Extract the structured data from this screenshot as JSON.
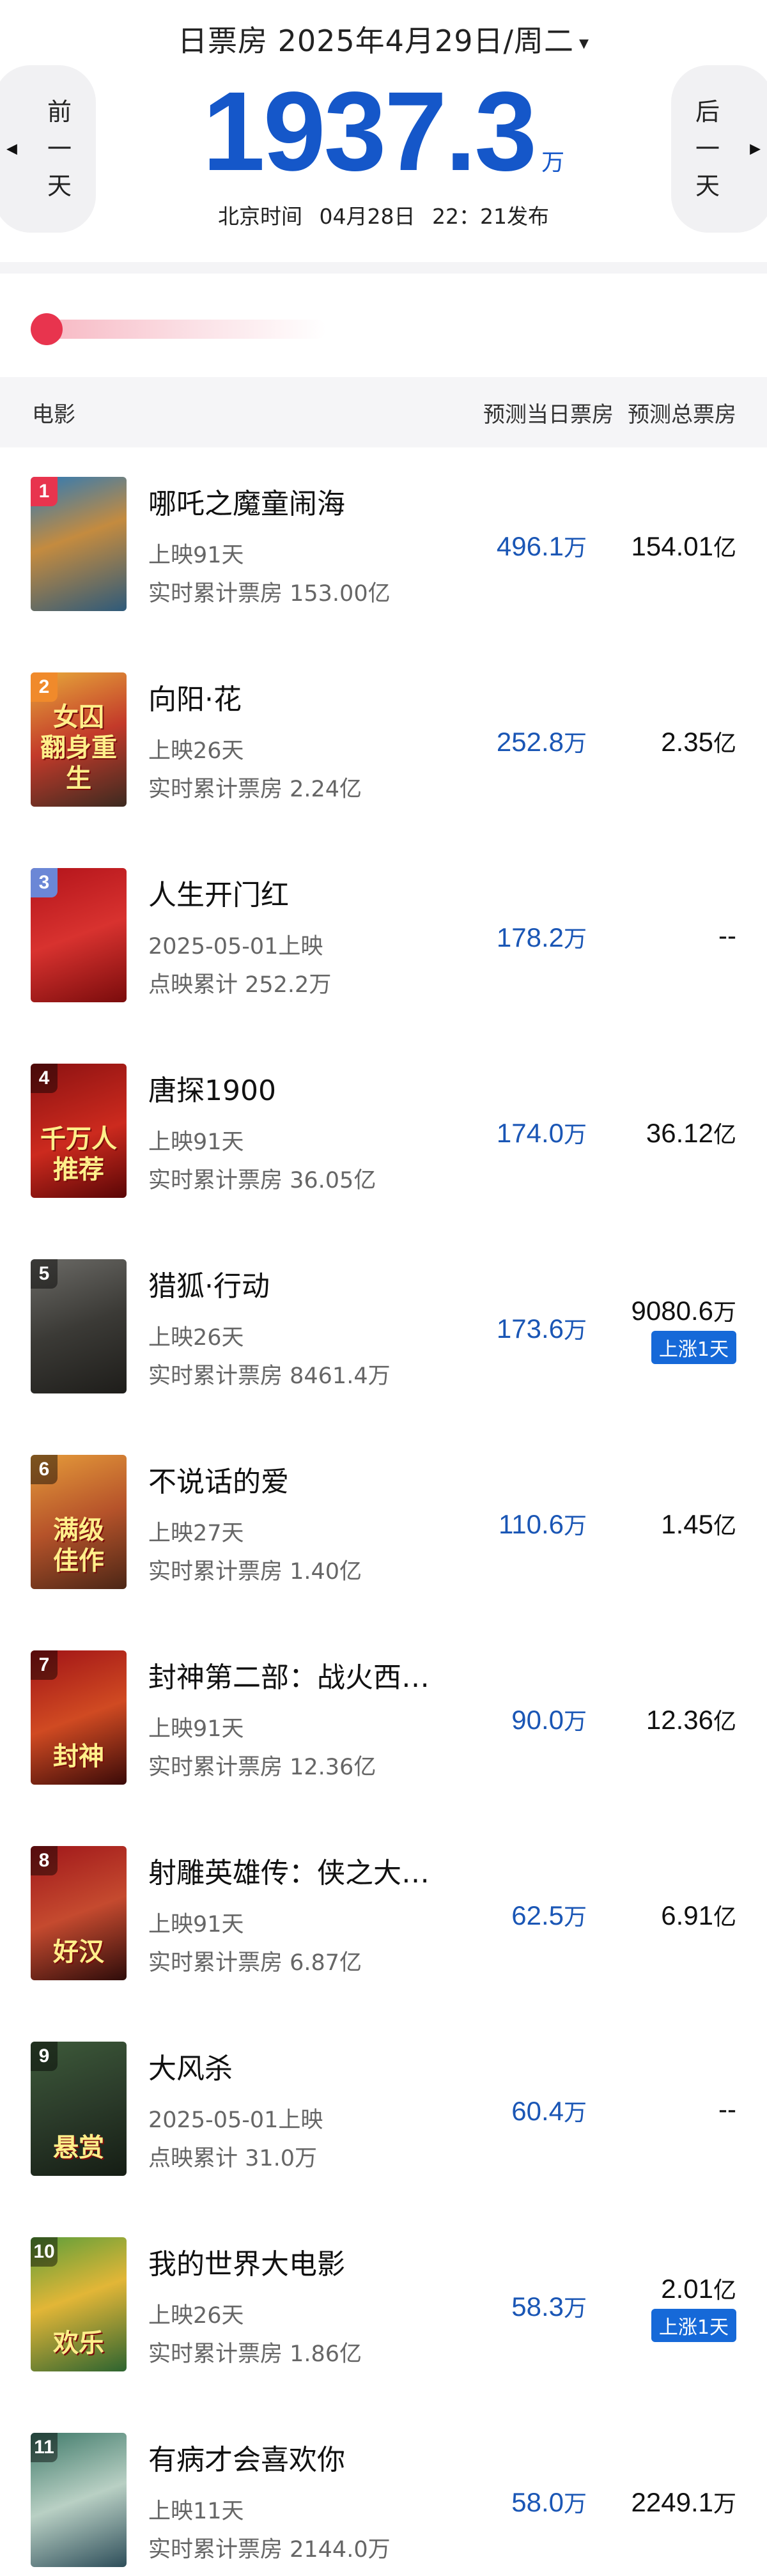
{
  "header": {
    "title": "日票房 2025年4月29日/周二",
    "caret": "▾",
    "prev_label": [
      "前",
      "一",
      "天"
    ],
    "next_label": [
      "后",
      "一",
      "天"
    ],
    "prev_arrow": "◀",
    "next_arrow": "▶",
    "total_value": "1937.3",
    "total_unit": "万",
    "publish_prefix": "北京时间",
    "publish_date": "04月28日",
    "publish_time": "22：21发布"
  },
  "columns": {
    "movie": "电影",
    "day": "预测当日票房",
    "total": "预测总票房"
  },
  "colors": {
    "accent_blue": "#1557c9",
    "badge_blue": "#1669d8",
    "rank_1": "#e8344e",
    "rank_2": "#f08a2b",
    "rank_3": "#6b87d6",
    "rank_other": "rgba(0,0,0,0.45)"
  },
  "movies": [
    {
      "rank": "1",
      "name": "哪吒之魔童闹海",
      "sub1": "上映91天",
      "sub2": "实时累计票房 153.00亿",
      "day_value": "496.1",
      "day_unit": "万",
      "total_value": "154.01",
      "total_unit": "亿",
      "badge": "",
      "poster_text": ""
    },
    {
      "rank": "2",
      "name": "向阳·花",
      "sub1": "上映26天",
      "sub2": "实时累计票房 2.24亿",
      "day_value": "252.8",
      "day_unit": "万",
      "total_value": "2.35",
      "total_unit": "亿",
      "badge": "",
      "poster_text": "女囚\n翻身重生"
    },
    {
      "rank": "3",
      "name": "人生开门红",
      "sub1": "2025-05-01上映",
      "sub2": "点映累计 252.2万",
      "day_value": "178.2",
      "day_unit": "万",
      "total_value": "--",
      "total_unit": "",
      "badge": "",
      "poster_text": ""
    },
    {
      "rank": "4",
      "name": "唐探1900",
      "sub1": "上映91天",
      "sub2": "实时累计票房 36.05亿",
      "day_value": "174.0",
      "day_unit": "万",
      "total_value": "36.12",
      "total_unit": "亿",
      "badge": "",
      "poster_text": "千万人推荐"
    },
    {
      "rank": "5",
      "name": "猎狐·行动",
      "sub1": "上映26天",
      "sub2": "实时累计票房 8461.4万",
      "day_value": "173.6",
      "day_unit": "万",
      "total_value": "9080.6",
      "total_unit": "万",
      "badge": "上涨1天",
      "poster_text": ""
    },
    {
      "rank": "6",
      "name": "不说话的爱",
      "sub1": "上映27天",
      "sub2": "实时累计票房 1.40亿",
      "day_value": "110.6",
      "day_unit": "万",
      "total_value": "1.45",
      "total_unit": "亿",
      "badge": "",
      "poster_text": "满级\n佳作"
    },
    {
      "rank": "7",
      "name": "封神第二部：战火西…",
      "sub1": "上映91天",
      "sub2": "实时累计票房 12.36亿",
      "day_value": "90.0",
      "day_unit": "万",
      "total_value": "12.36",
      "total_unit": "亿",
      "badge": "",
      "poster_text": "封神"
    },
    {
      "rank": "8",
      "name": "射雕英雄传：侠之大…",
      "sub1": "上映91天",
      "sub2": "实时累计票房 6.87亿",
      "day_value": "62.5",
      "day_unit": "万",
      "total_value": "6.91",
      "total_unit": "亿",
      "badge": "",
      "poster_text": "好汉"
    },
    {
      "rank": "9",
      "name": "大风杀",
      "sub1": "2025-05-01上映",
      "sub2": "点映累计 31.0万",
      "day_value": "60.4",
      "day_unit": "万",
      "total_value": "--",
      "total_unit": "",
      "badge": "",
      "poster_text": "悬赏"
    },
    {
      "rank": "10",
      "name": "我的世界大电影",
      "sub1": "上映26天",
      "sub2": "实时累计票房 1.86亿",
      "day_value": "58.3",
      "day_unit": "万",
      "total_value": "2.01",
      "total_unit": "亿",
      "badge": "上涨1天",
      "poster_text": "欢乐"
    },
    {
      "rank": "11",
      "name": "有病才会喜欢你",
      "sub1": "上映11天",
      "sub2": "实时累计票房 2144.0万",
      "day_value": "58.0",
      "day_unit": "万",
      "total_value": "2249.1",
      "total_unit": "万",
      "badge": "",
      "poster_text": ""
    }
  ]
}
